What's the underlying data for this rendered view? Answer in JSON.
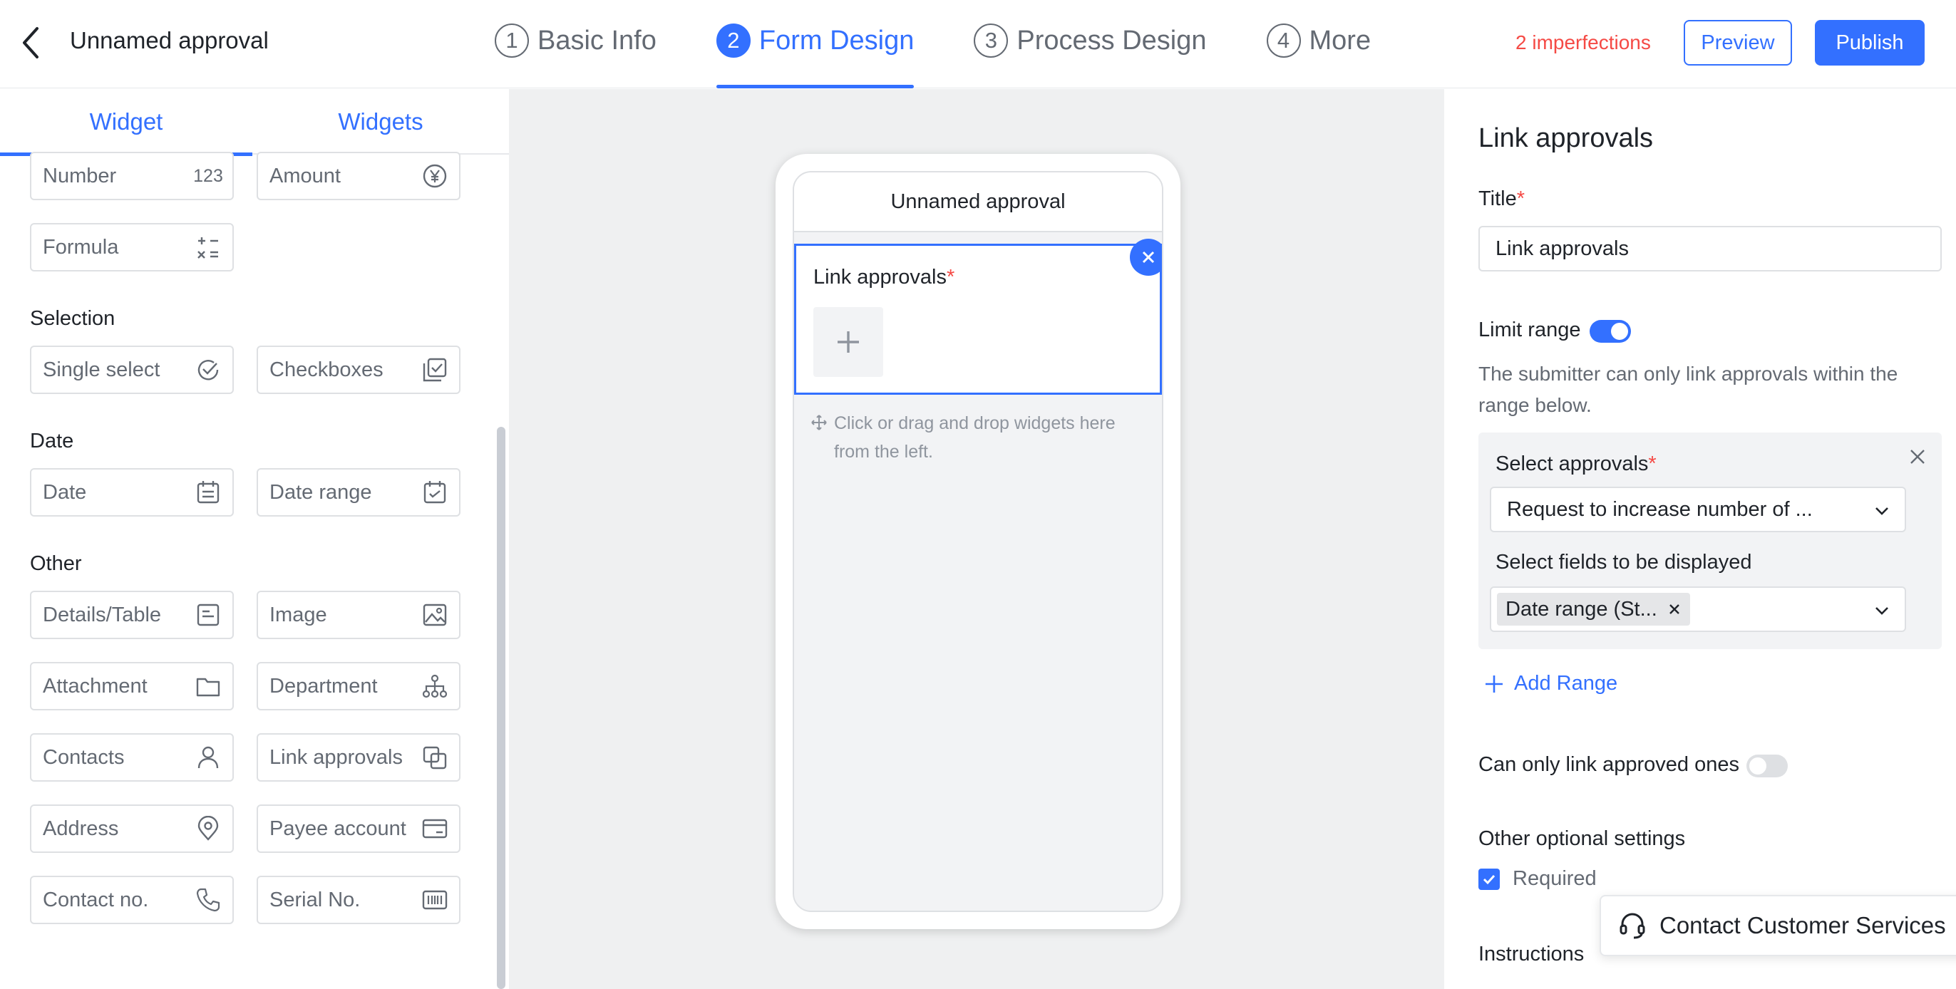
{
  "header": {
    "title": "Unnamed approval",
    "steps": [
      {
        "num": "1",
        "label": "Basic Info"
      },
      {
        "num": "2",
        "label": "Form Design"
      },
      {
        "num": "3",
        "label": "Process Design"
      },
      {
        "num": "4",
        "label": "More"
      }
    ],
    "active_step": "Form Design",
    "imperfections": "2 imperfections",
    "preview_label": "Preview",
    "publish_label": "Publish"
  },
  "left": {
    "tabs": [
      "Widget",
      "Widgets"
    ],
    "active_tab": "Widget",
    "number_badge": "123",
    "widgets": {
      "number": "Number",
      "amount": "Amount",
      "formula": "Formula",
      "single_select": "Single select",
      "checkboxes": "Checkboxes",
      "date": "Date",
      "date_range": "Date range",
      "details_table": "Details/Table",
      "image": "Image",
      "attachment": "Attachment",
      "department": "Department",
      "contacts": "Contacts",
      "link_approvals": "Link approvals",
      "address": "Address",
      "payee_account": "Payee account",
      "contact_no": "Contact no.",
      "serial_no": "Serial No."
    },
    "sections": {
      "selection": "Selection",
      "date": "Date",
      "other": "Other"
    }
  },
  "canvas": {
    "form_title": "Unnamed approval",
    "field_label": "Link approvals",
    "required_mark": "*",
    "drop_hint": "Click or drag and drop widgets here from the left."
  },
  "right": {
    "heading": "Link approvals",
    "title_label": "Title",
    "title_value": "Link approvals",
    "limit_range_label": "Limit range",
    "limit_range_on": true,
    "limit_desc": "The submitter can only link approvals within the range below.",
    "select_approvals_label": "Select approvals",
    "select_approvals_value": "Request to increase number of ...",
    "select_fields_label": "Select fields to be displayed",
    "selected_field_tag": "Date range (St...",
    "add_range": "Add Range",
    "only_approved_label": "Can only link approved ones",
    "only_approved_on": false,
    "other_settings_label": "Other optional settings",
    "required_label": "Required",
    "required_checked": true,
    "instructions_label": "Instructions"
  },
  "contact_cs": "Contact Customer Services",
  "colors": {
    "accent": "#3370ff",
    "danger": "#f54a45",
    "canvas_bg": "#eff0f1"
  }
}
